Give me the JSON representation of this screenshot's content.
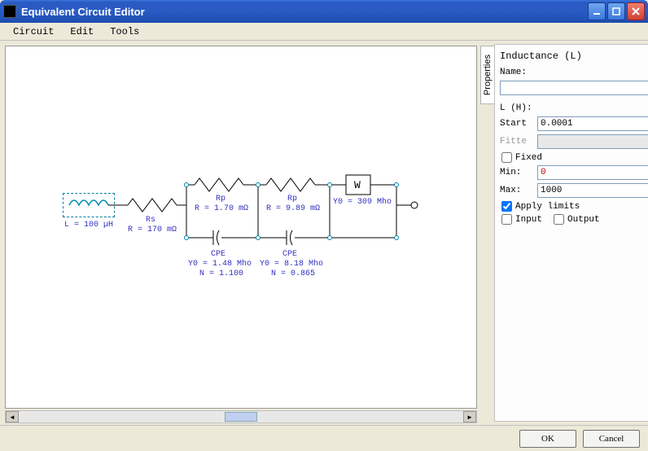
{
  "window": {
    "title": "Equivalent Circuit Editor"
  },
  "menu": {
    "circuit": "Circuit",
    "edit": "Edit",
    "tools": "Tools"
  },
  "sidebar_tab": "Properties",
  "panel": {
    "title": "Inductance (L)",
    "name_label": "Name:",
    "name_value": "",
    "lh_label": "L (H):",
    "start_label": "Start",
    "start_value": "0.0001",
    "fitte_label": "Fitte",
    "fitte_value": "",
    "fixed_label": "Fixed",
    "min_label": "Min:",
    "min_value": "0",
    "max_label": "Max:",
    "max_value": "1000",
    "apply_limits_label": "Apply limits",
    "input_label": "Input",
    "output_label": "Output"
  },
  "buttons": {
    "ok": "OK",
    "cancel": "Cancel"
  },
  "circuit": {
    "L": {
      "name": "L",
      "value": "L = 100 µH"
    },
    "Rs": {
      "name": "Rs",
      "value": "R = 170 mΩ"
    },
    "Rp1": {
      "name": "Rp",
      "value": "R = 1.70 mΩ"
    },
    "CPE1": {
      "name": "CPE",
      "v1": "Y0 = 1.48 Mho",
      "v2": "N = 1.100"
    },
    "Rp2": {
      "name": "Rp",
      "value": "R = 9.89 mΩ"
    },
    "CPE2": {
      "name": "CPE",
      "v1": "Y0 = 8.18 Mho",
      "v2": "N = 0.865"
    },
    "W": {
      "name": "W",
      "value": "Y0 = 309 Mho"
    }
  }
}
